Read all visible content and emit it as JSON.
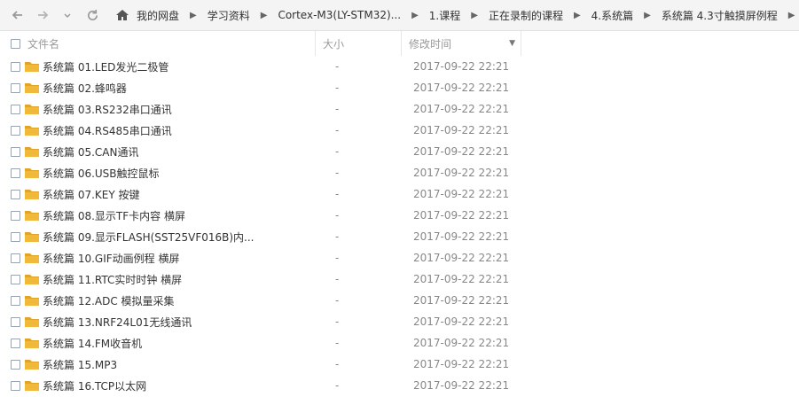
{
  "toolbar": {
    "breadcrumb": [
      "我的网盘",
      "学习资料",
      "Cortex-M3(LY-STM32)...",
      "1.课程",
      "正在录制的课程",
      "4.系统篇",
      "系统篇 4.3寸触摸屏例程"
    ]
  },
  "header": {
    "name": "文件名",
    "size": "大小",
    "date": "修改时间"
  },
  "files": [
    {
      "name": "系统篇 01.LED发光二极管",
      "size": "-",
      "date": "2017-09-22 22:21"
    },
    {
      "name": "系统篇 02.蜂鸣器",
      "size": "-",
      "date": "2017-09-22 22:21"
    },
    {
      "name": "系统篇 03.RS232串口通讯",
      "size": "-",
      "date": "2017-09-22 22:21"
    },
    {
      "name": "系统篇 04.RS485串口通讯",
      "size": "-",
      "date": "2017-09-22 22:21"
    },
    {
      "name": "系统篇 05.CAN通讯",
      "size": "-",
      "date": "2017-09-22 22:21"
    },
    {
      "name": "系统篇 06.USB触控鼠标",
      "size": "-",
      "date": "2017-09-22 22:21"
    },
    {
      "name": "系统篇 07.KEY 按键",
      "size": "-",
      "date": "2017-09-22 22:21"
    },
    {
      "name": "系统篇 08.显示TF卡内容 横屏",
      "size": "-",
      "date": "2017-09-22 22:21"
    },
    {
      "name": "系统篇 09.显示FLASH(SST25VF016B)内...",
      "size": "-",
      "date": "2017-09-22 22:21"
    },
    {
      "name": "系统篇 10.GIF动画例程 横屏",
      "size": "-",
      "date": "2017-09-22 22:21"
    },
    {
      "name": "系统篇 11.RTC实时时钟 横屏",
      "size": "-",
      "date": "2017-09-22 22:21"
    },
    {
      "name": "系统篇 12.ADC 模拟量采集",
      "size": "-",
      "date": "2017-09-22 22:21"
    },
    {
      "name": "系统篇 13.NRF24L01无线通讯",
      "size": "-",
      "date": "2017-09-22 22:21"
    },
    {
      "name": "系统篇 14.FM收音机",
      "size": "-",
      "date": "2017-09-22 22:21"
    },
    {
      "name": "系统篇 15.MP3",
      "size": "-",
      "date": "2017-09-22 22:21"
    },
    {
      "name": "系统篇 16.TCP以太网",
      "size": "-",
      "date": "2017-09-22 22:21"
    }
  ],
  "colors": {
    "folder": "#f0b93a",
    "folder_dark": "#e0a429"
  }
}
